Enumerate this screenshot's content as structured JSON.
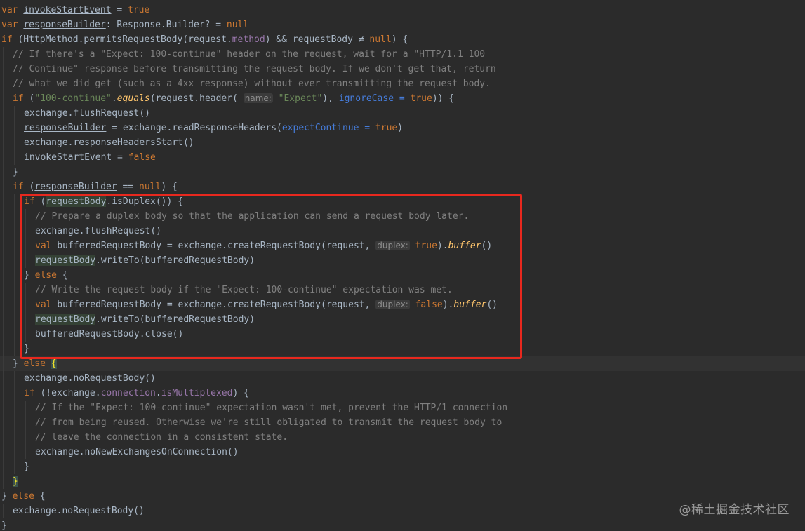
{
  "editor": {
    "language": "kotlin",
    "theme_colors": {
      "background": "#2b2b2b",
      "keyword": "#cc7832",
      "comment": "#808080",
      "string": "#6a8759",
      "property": "#9876aa",
      "function_call": "#ffc66d",
      "named_argument": "#467cda",
      "selection_box": "#e8281e"
    },
    "lines": [
      [
        {
          "t": "var",
          "c": "kw"
        },
        {
          "t": " "
        },
        {
          "t": "invokeStartEvent",
          "c": "uvar"
        },
        {
          "t": " = "
        },
        {
          "t": "true",
          "c": "kw"
        }
      ],
      [
        {
          "t": "var",
          "c": "kw"
        },
        {
          "t": " "
        },
        {
          "t": "responseBuilder",
          "c": "uvar"
        },
        {
          "t": ": Response.Builder? = "
        },
        {
          "t": "null",
          "c": "kw"
        }
      ],
      [
        {
          "t": "if",
          "c": "kw"
        },
        {
          "t": " (HttpMethod.permitsRequestBody(request."
        },
        {
          "t": "method",
          "c": "prop"
        },
        {
          "t": ") && requestBody ≠ "
        },
        {
          "t": "null",
          "c": "kw"
        },
        {
          "t": ") {"
        }
      ],
      [
        {
          "t": "// If there's a \"Expect: 100-continue\" header on the request, wait for a \"HTTP/1.1 100",
          "c": "cm"
        }
      ],
      [
        {
          "t": "// Continue\" response before transmitting the request body. If we don't get that, return",
          "c": "cm"
        }
      ],
      [
        {
          "t": "// what we did get (such as a 4xx response) without ever transmitting the request body.",
          "c": "cm"
        }
      ],
      [
        {
          "t": "if",
          "c": "kw"
        },
        {
          "t": " ("
        },
        {
          "t": "\"100-continue\"",
          "c": "str"
        },
        {
          "t": "."
        },
        {
          "t": "equals",
          "c": "fn"
        },
        {
          "t": "(request.header( "
        },
        {
          "t": "name:",
          "c": "hint"
        },
        {
          "t": " "
        },
        {
          "t": "\"Expect\"",
          "c": "str"
        },
        {
          "t": "), "
        },
        {
          "t": "ignoreCase = ",
          "c": "named"
        },
        {
          "t": "true",
          "c": "kw"
        },
        {
          "t": ")) {"
        }
      ],
      [
        {
          "t": "exchange.flushRequest()"
        }
      ],
      [
        {
          "t": "responseBuilder",
          "c": "uvar"
        },
        {
          "t": " = exchange.readResponseHeaders("
        },
        {
          "t": "expectContinue = ",
          "c": "named"
        },
        {
          "t": "true",
          "c": "kw"
        },
        {
          "t": ")"
        }
      ],
      [
        {
          "t": "exchange.responseHeadersStart()"
        }
      ],
      [
        {
          "t": "invokeStartEvent",
          "c": "uvar"
        },
        {
          "t": " = "
        },
        {
          "t": "false",
          "c": "kw"
        }
      ],
      [
        {
          "t": "}"
        }
      ],
      [
        {
          "t": "if",
          "c": "kw"
        },
        {
          "t": " ("
        },
        {
          "t": "responseBuilder",
          "c": "uvar"
        },
        {
          "t": " == "
        },
        {
          "t": "null",
          "c": "kw"
        },
        {
          "t": ") {"
        }
      ],
      [
        {
          "t": "if",
          "c": "kw"
        },
        {
          "t": " ("
        },
        {
          "t": "requestBody",
          "c": "hl-usage"
        },
        {
          "t": ".isDuplex()) {"
        }
      ],
      [
        {
          "t": "// Prepare a duplex body so that the application can send a request body later.",
          "c": "cm"
        }
      ],
      [
        {
          "t": "exchange.flushRequest()"
        }
      ],
      [
        {
          "t": "val",
          "c": "kw"
        },
        {
          "t": " bufferedRequestBody = exchange.createRequestBody(request, "
        },
        {
          "t": "duplex:",
          "c": "hint"
        },
        {
          "t": " "
        },
        {
          "t": "true",
          "c": "kw"
        },
        {
          "t": ")."
        },
        {
          "t": "buffer",
          "c": "fn"
        },
        {
          "t": "()"
        }
      ],
      [
        {
          "t": "requestBody",
          "c": "hl-usage"
        },
        {
          "t": ".writeTo(bufferedRequestBody)"
        }
      ],
      [
        {
          "t": "} "
        },
        {
          "t": "else",
          "c": "kw"
        },
        {
          "t": " {"
        }
      ],
      [
        {
          "t": "// Write the request body if the \"Expect: 100-continue\" expectation was met.",
          "c": "cm"
        }
      ],
      [
        {
          "t": "val",
          "c": "kw"
        },
        {
          "t": " bufferedRequestBody = exchange.createRequestBody(request, "
        },
        {
          "t": "duplex:",
          "c": "hint"
        },
        {
          "t": " "
        },
        {
          "t": "false",
          "c": "kw"
        },
        {
          "t": ")."
        },
        {
          "t": "buffer",
          "c": "fn"
        },
        {
          "t": "()"
        }
      ],
      [
        {
          "t": "requestBody",
          "c": "hl-usage"
        },
        {
          "t": ".writeTo(bufferedRequestBody)"
        }
      ],
      [
        {
          "t": "bufferedRequestBody.close()"
        }
      ],
      [
        {
          "t": "}"
        }
      ],
      [
        {
          "t": "} "
        },
        {
          "t": "else",
          "c": "kw"
        },
        {
          "t": " "
        },
        {
          "t": "{",
          "c": "brace-match"
        }
      ],
      [
        {
          "t": "exchange.noRequestBody()"
        }
      ],
      [
        {
          "t": "if",
          "c": "kw"
        },
        {
          "t": " (!exchange."
        },
        {
          "t": "connection",
          "c": "prop"
        },
        {
          "t": "."
        },
        {
          "t": "isMultiplexed",
          "c": "prop"
        },
        {
          "t": ") {"
        }
      ],
      [
        {
          "t": "// If the \"Expect: 100-continue\" expectation wasn't met, prevent the HTTP/1 connection",
          "c": "cm"
        }
      ],
      [
        {
          "t": "// from being reused. Otherwise we're still obligated to transmit the request body to",
          "c": "cm"
        }
      ],
      [
        {
          "t": "// leave the connection in a consistent state.",
          "c": "cm"
        }
      ],
      [
        {
          "t": "exchange.noNewExchangesOnConnection()"
        }
      ],
      [
        {
          "t": "}"
        }
      ],
      [
        {
          "t": "}",
          "c": "brace-match"
        }
      ],
      [
        {
          "t": "} "
        },
        {
          "t": "else",
          "c": "kw"
        },
        {
          "t": " {"
        }
      ],
      [
        {
          "t": "exchange.noRequestBody()"
        }
      ],
      [
        {
          "t": "}"
        }
      ]
    ]
  },
  "watermark": {
    "text": "@稀土掘金技术社区"
  }
}
